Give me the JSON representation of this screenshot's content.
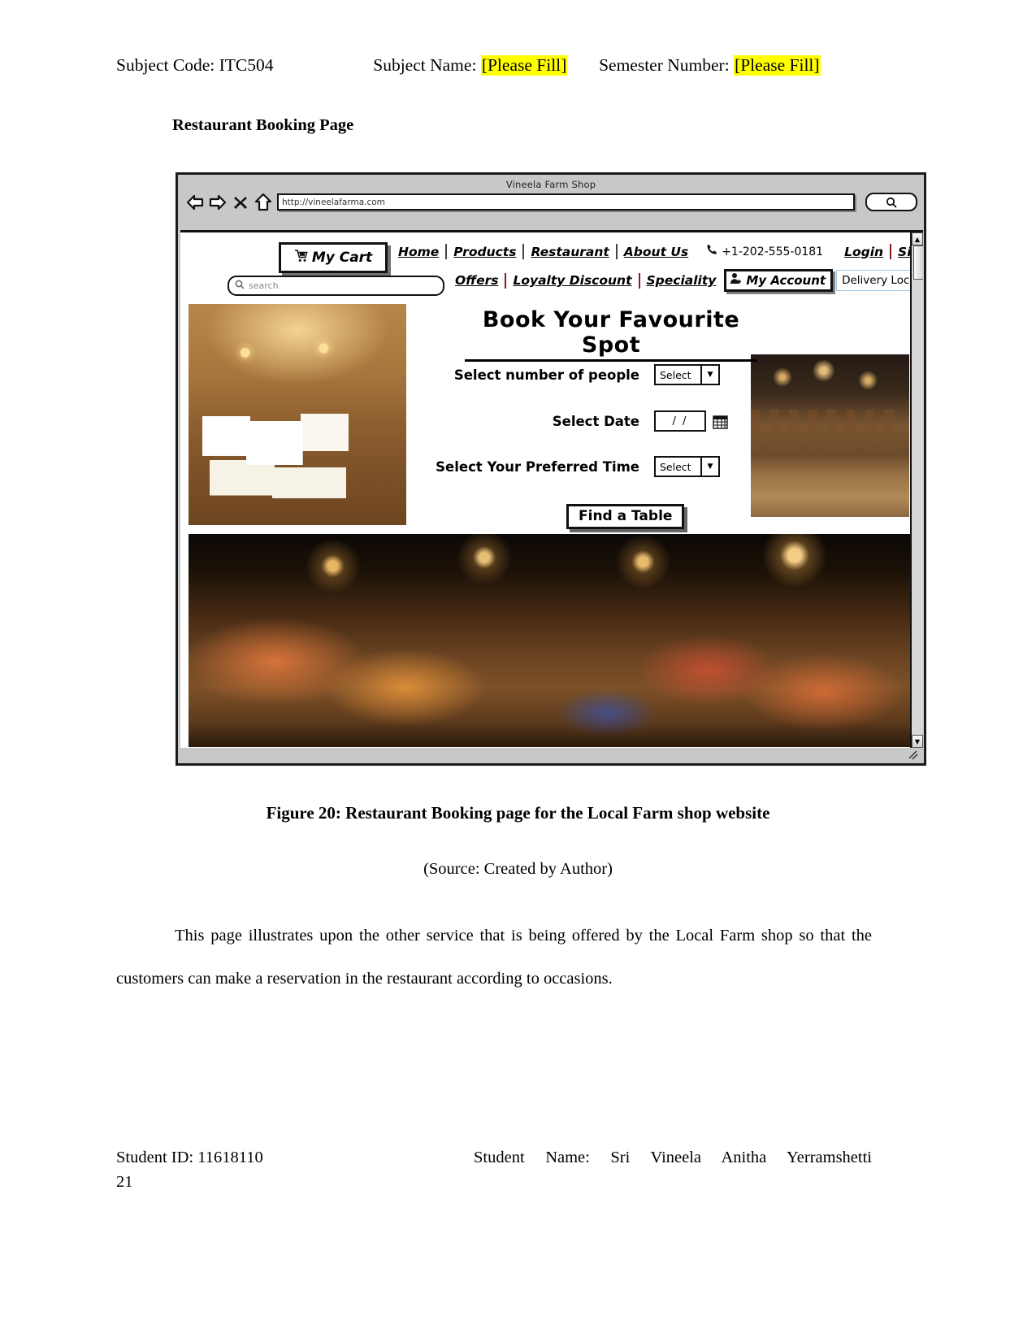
{
  "doc_header": {
    "subject_code_label": "Subject Code:",
    "subject_code_value": "ITC504",
    "subject_name_label": "Subject Name:",
    "subject_name_value": "[Please Fill]",
    "semester_label": "Semester Number:",
    "semester_value": "[Please Fill]"
  },
  "section_title": "Restaurant Booking Page",
  "browser": {
    "window_title": "Vineela Farm Shop",
    "url": "http://vineelafarma.com",
    "back_icon": "back-arrow-icon",
    "forward_icon": "forward-arrow-icon",
    "stop_icon": "close-x-icon",
    "home_icon": "home-icon",
    "browser_search_icon": "search-icon"
  },
  "site": {
    "cart_label": "My Cart",
    "cart_icon": "cart-icon",
    "search_placeholder": "search",
    "search_icon": "search-icon",
    "nav_primary": [
      "Home",
      "Products",
      "Restaurant",
      "About Us"
    ],
    "phone_icon": "phone-icon",
    "phone": "+1-202-555-0181",
    "login": "Login",
    "signup": "Signup",
    "nav_secondary": [
      "Offers",
      "Loyalty Discount",
      "Speciality"
    ],
    "account_label": "My Account",
    "account_icon": "user-add-icon",
    "delivery_location": "Delivery Location",
    "delivery_caret_icon": "chevron-down-icon"
  },
  "booking": {
    "title": "Book Your Favourite Spot",
    "people_label": "Select number of people",
    "people_value": "Select",
    "date_label": "Select Date",
    "date_value": "/ /",
    "calendar_icon": "calendar-icon",
    "time_label": "Select Your Preferred Time",
    "time_value": "Select",
    "find_table_label": "Find a Table",
    "dropdown_caret_icon": "caret-down-icon"
  },
  "scrollbar": {
    "up_icon": "scroll-up-arrow-icon",
    "down_icon": "scroll-down-arrow-icon",
    "resize_grip_icon": "resize-grip-icon"
  },
  "figure": {
    "caption": "Figure 20: Restaurant Booking page for the Local Farm shop website",
    "source": "(Source: Created by Author)"
  },
  "body_paragraph": "This page illustrates upon the other service that is being offered by the Local Farm shop so that the customers can make a reservation in the restaurant according to occasions.",
  "footer": {
    "student_id": "Student ID: 11618110",
    "student_name": "Student Name: Sri Vineela Anitha Yerramshetti",
    "page_number": "21"
  }
}
